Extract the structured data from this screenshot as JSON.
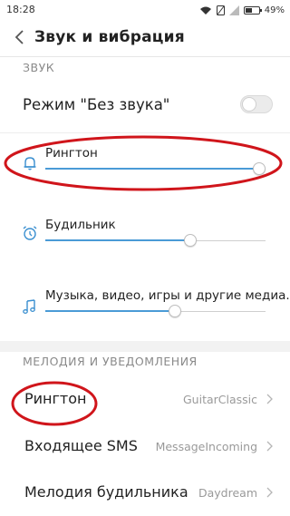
{
  "statusbar": {
    "time": "18:28",
    "battery": "49%",
    "battery_level": 0.49
  },
  "header": {
    "title": "Звук и вибрация"
  },
  "sound_section": {
    "title": "ЗВУК",
    "silent_mode": {
      "label": "Режим \"Без звука\"",
      "enabled": false
    },
    "ringtone_volume": {
      "label": "Рингтон",
      "level": 0.97
    },
    "alarm_volume": {
      "label": "Будильник",
      "level": 0.66
    },
    "media_volume": {
      "label": "Музыка, видео, игры и другие медиа...",
      "level": 0.59
    }
  },
  "melody_section": {
    "title": "МЕЛОДИЯ И УВЕДОМЛЕНИЯ",
    "items": [
      {
        "label": "Рингтон",
        "value": "GuitarClassic"
      },
      {
        "label": "Входящее SMS",
        "value": "MessageIncoming"
      },
      {
        "label": "Мелодия будильника",
        "value": "Daydream"
      }
    ]
  },
  "colors": {
    "accent": "#4a9bd6",
    "annotation": "#d0151b"
  }
}
